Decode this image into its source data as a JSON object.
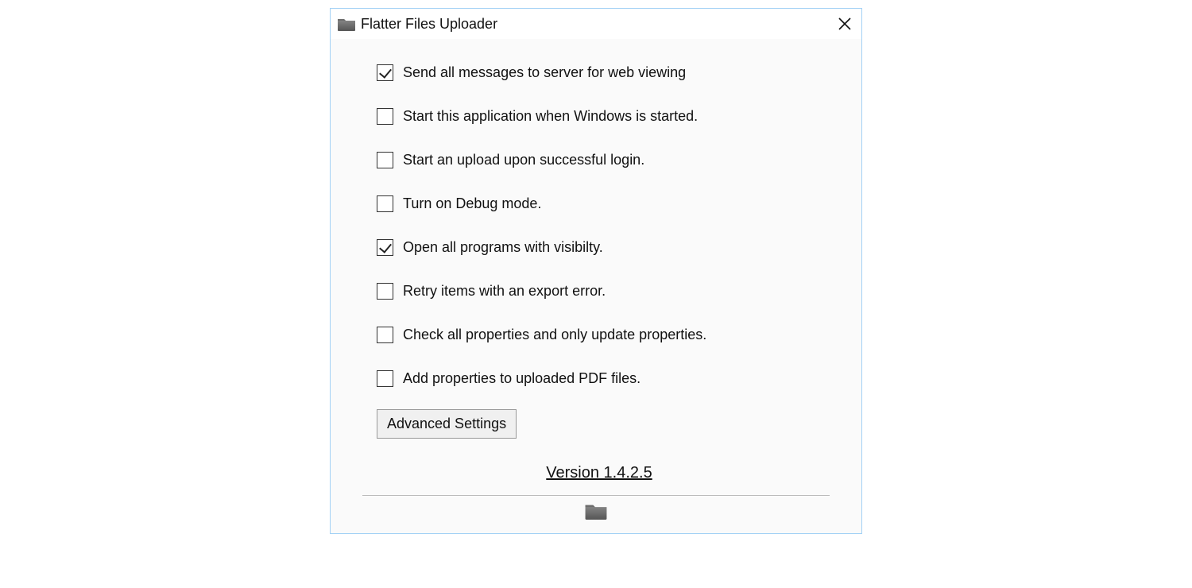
{
  "window": {
    "title": "Flatter Files Uploader"
  },
  "options": [
    {
      "checked": true,
      "label": "Send all messages to server for web viewing"
    },
    {
      "checked": false,
      "label": "Start this application when Windows is started."
    },
    {
      "checked": false,
      "label": "Start an upload upon successful login."
    },
    {
      "checked": false,
      "label": "Turn on Debug mode."
    },
    {
      "checked": true,
      "label": "Open all programs with visibilty."
    },
    {
      "checked": false,
      "label": "Retry items with an export error."
    },
    {
      "checked": false,
      "label": "Check all properties and only update properties."
    },
    {
      "checked": false,
      "label": "Add properties to uploaded PDF files."
    }
  ],
  "buttons": {
    "advanced": "Advanced Settings"
  },
  "version": {
    "label": "Version 1.4.2.5"
  }
}
